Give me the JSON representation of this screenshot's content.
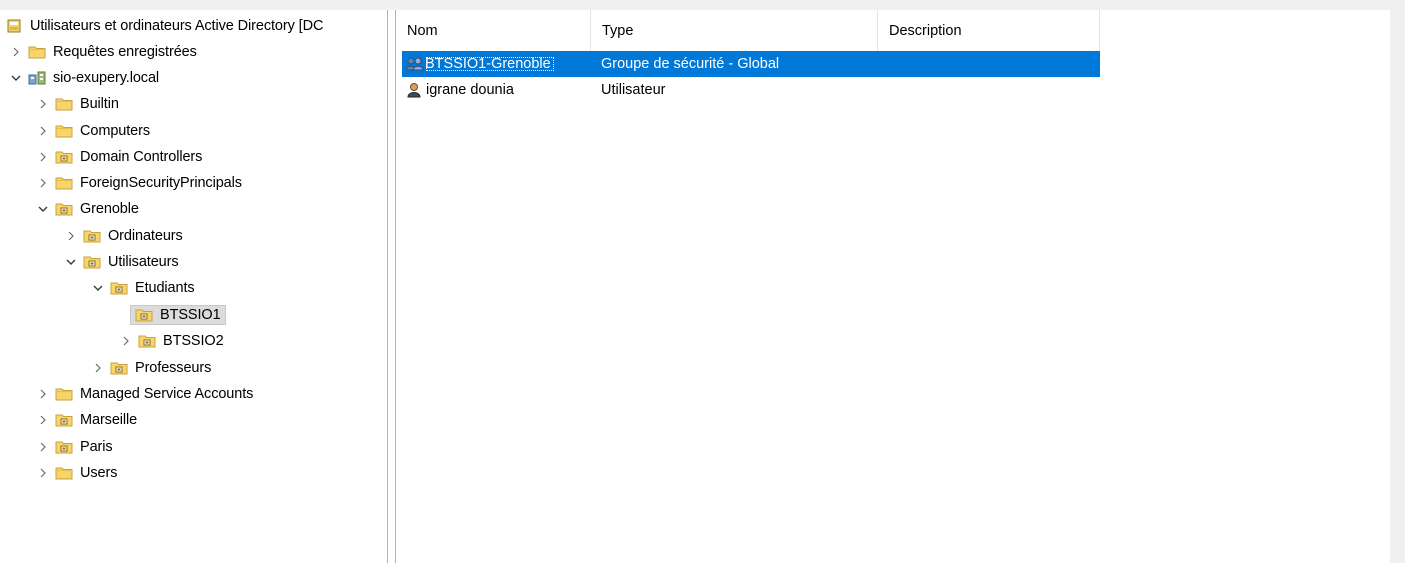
{
  "tree": {
    "root": "Utilisateurs et ordinateurs Active Directory [DC",
    "saved_queries": "Requêtes enregistrées",
    "domain": "sio-exupery.local",
    "items": {
      "builtin": "Builtin",
      "computers": "Computers",
      "domain_controllers": "Domain Controllers",
      "foreign": "ForeignSecurityPrincipals",
      "grenoble": "Grenoble",
      "ordinateurs": "Ordinateurs",
      "utilisateurs": "Utilisateurs",
      "etudiants": "Etudiants",
      "btssio1": "BTSSIO1",
      "btssio2": "BTSSIO2",
      "professeurs": "Professeurs",
      "managed": "Managed Service Accounts",
      "marseille": "Marseille",
      "paris": "Paris",
      "users": "Users"
    }
  },
  "list": {
    "columns": {
      "name": "Nom",
      "type": "Type",
      "description": "Description"
    },
    "rows": [
      {
        "name": "BTSSIO1-Grenoble",
        "type": "Groupe de sécurité - Global",
        "description": "",
        "icon": "group-icon",
        "selected": true
      },
      {
        "name": "igrane dounia",
        "type": "Utilisateur",
        "description": "",
        "icon": "user-icon",
        "selected": false
      }
    ]
  },
  "colors": {
    "selection": "#0078d7",
    "folder": "#f7d56a",
    "ou_badge": "#b08a2e"
  }
}
